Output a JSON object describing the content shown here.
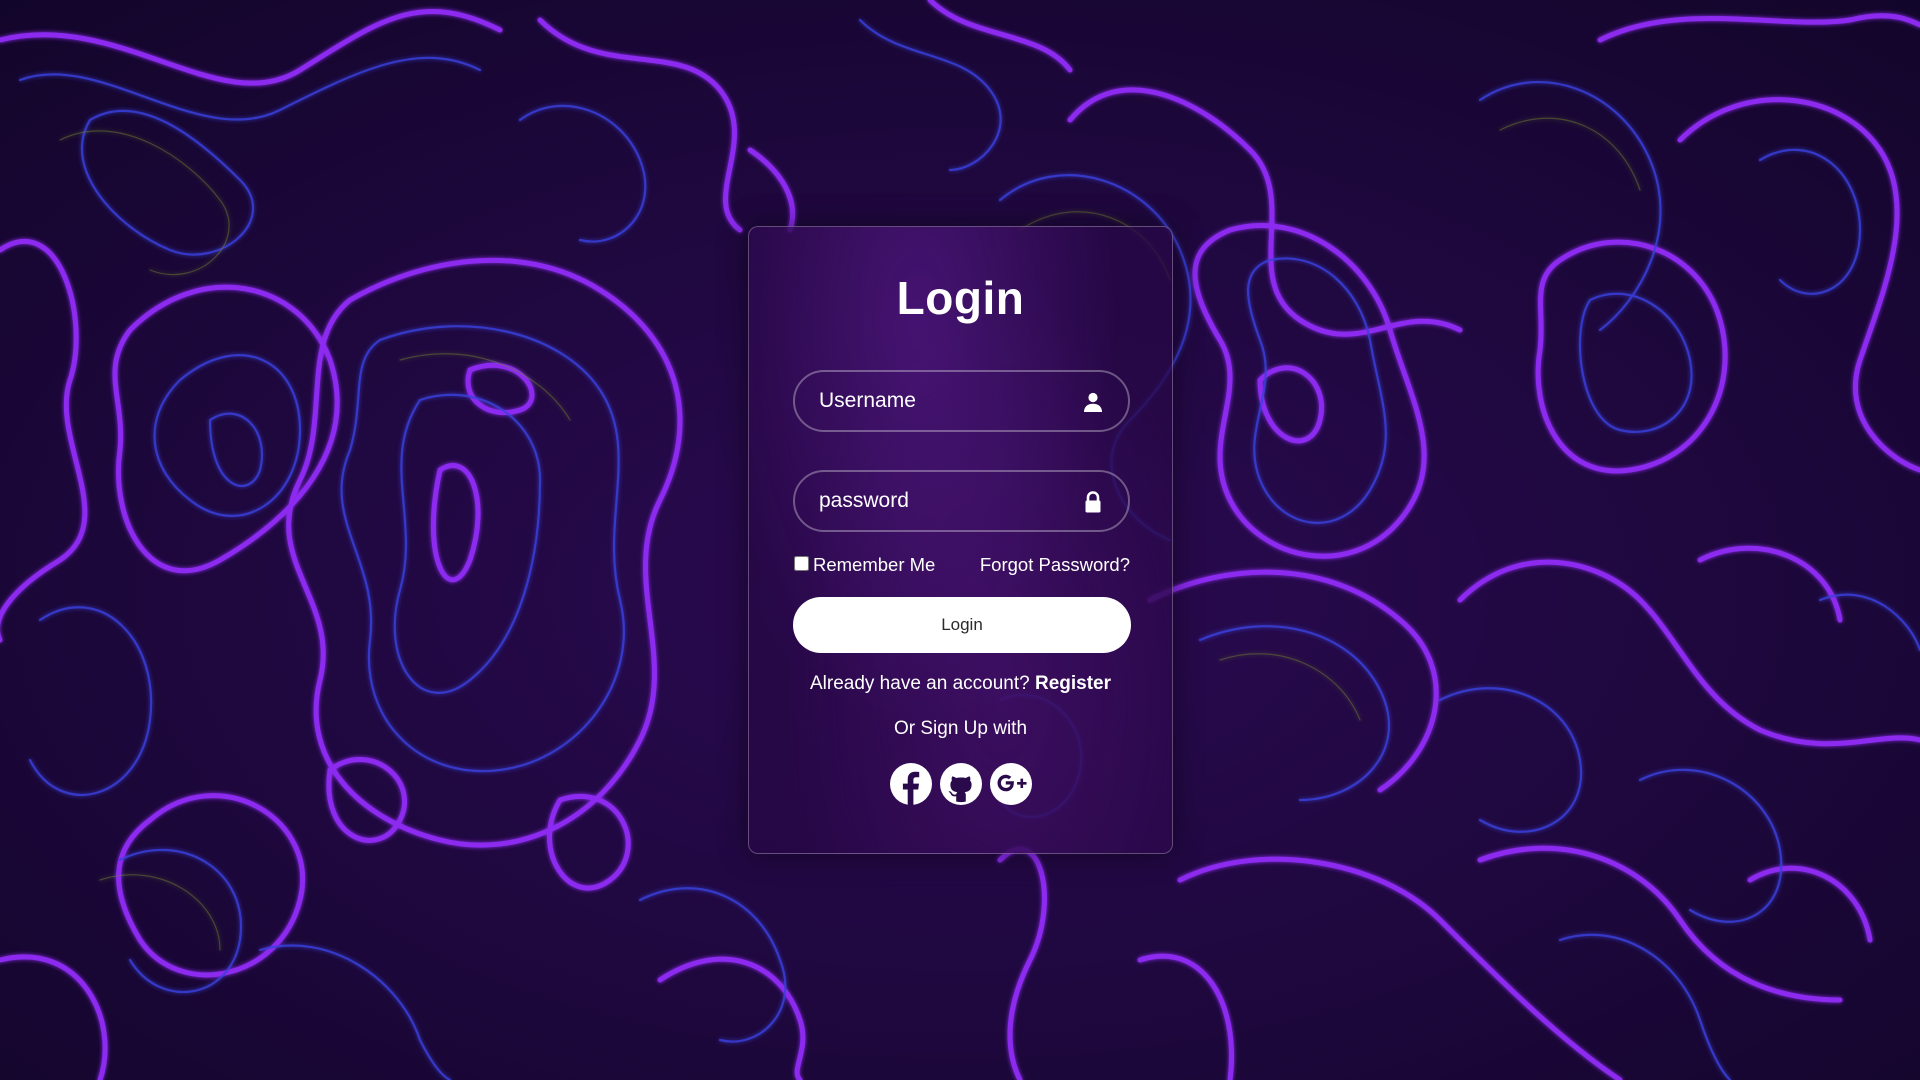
{
  "login_form": {
    "title": "Login",
    "username_placeholder": "Username",
    "password_placeholder": "password",
    "remember_label": "Remember Me",
    "remember_checked": false,
    "forgot_label": "Forgot Password?",
    "submit_label": "Login",
    "register_prompt": "Already have an account? ",
    "register_link": "Register",
    "signup_with": "Or Sign Up with",
    "social_icons": [
      "facebook-icon",
      "github-icon",
      "google-plus-icon"
    ]
  },
  "colors": {
    "background": "#16062c",
    "contour_purple": "#8a2be2",
    "contour_blue": "#3b3bd6",
    "card": "#2a0a4a",
    "button": "#ffffff",
    "text": "#ffffff"
  }
}
